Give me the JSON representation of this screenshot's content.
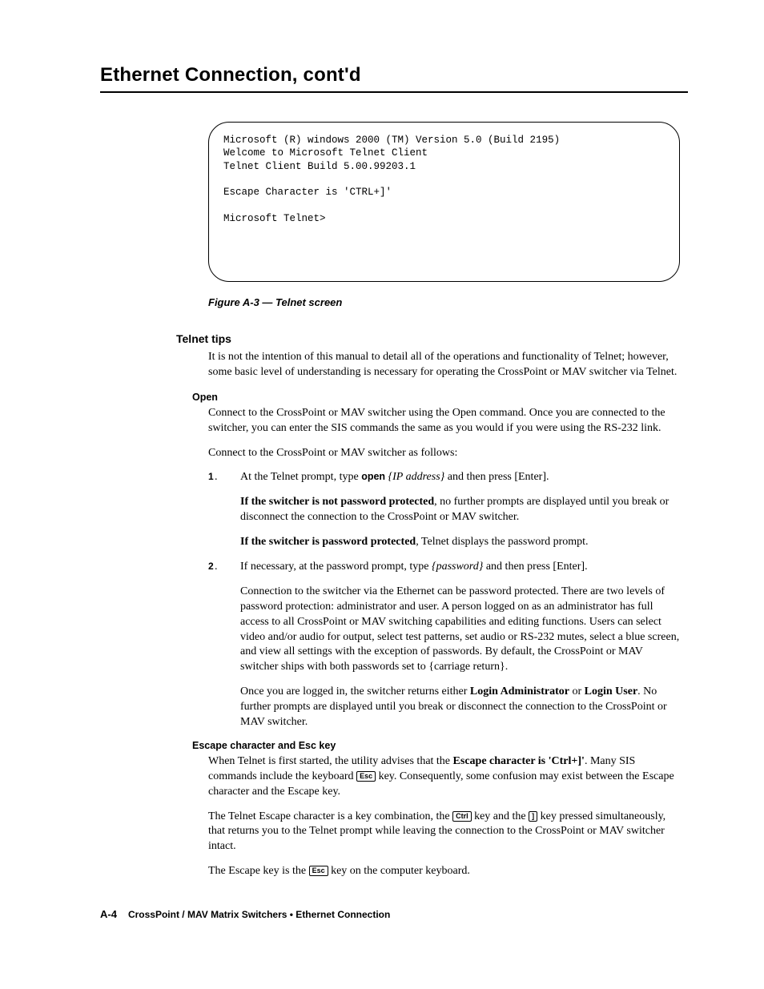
{
  "chapter": {
    "title": "Ethernet Connection, cont'd"
  },
  "telnet": {
    "line1": "Microsoft (R) windows 2000 (TM) Version 5.0 (Build 2195)",
    "line2": "Welcome to Microsoft Telnet Client",
    "line3": "Telnet Client Build 5.00.99203.1",
    "line4": "Escape Character is 'CTRL+]'",
    "line5": "Microsoft Telnet>"
  },
  "figure": {
    "caption": "Figure A-3 — Telnet screen"
  },
  "tips": {
    "heading": "Telnet tips",
    "intro": "It is not the intention of this manual to detail all of the operations and functionality of Telnet; however, some basic level of understanding is necessary for operating the CrossPoint or MAV switcher via Telnet."
  },
  "open": {
    "heading": "Open",
    "p1": "Connect to the CrossPoint or MAV switcher using the Open command.  Once you are connected to the switcher, you can enter the SIS commands the same as you would if you were using the RS-232 link.",
    "p2": "Connect to the CrossPoint or MAV switcher as follows:",
    "step1_lead": "At the Telnet prompt, type ",
    "step1_cmd": "open",
    "step1_arg": " {IP address}",
    "step1_tail": " and then press [Enter].",
    "step1_np_lead": "If the switcher is not password protected",
    "step1_np_tail": ", no further prompts are displayed until you break or disconnect the connection to the CrossPoint or MAV switcher.",
    "step1_pp_lead": "If the switcher is password protected",
    "step1_pp_tail": ", Telnet displays the password prompt.",
    "step2_lead": "If necessary, at the password prompt, type ",
    "step2_arg": "{password}",
    "step2_tail": " and then press [Enter].",
    "step2_p2": "Connection to the switcher via the Ethernet can be password protected.  There are two levels of password protection: administrator and user.  A person logged on as an administrator has full access to all CrossPoint or MAV switching capabilities and editing functions.  Users can select video and/or audio for output, select test patterns, set audio or RS-232 mutes, select a blue screen, and view all settings with the exception of passwords.  By default, the CrossPoint or MAV switcher ships with both passwords set to {carriage return}.",
    "step2_p3a": "Once you are logged in, the switcher returns either ",
    "step2_la": "Login Administrator",
    "step2_or": " or ",
    "step2_lu": "Login User",
    "step2_p3b": ".  No further prompts are displayed until you break or disconnect the connection to the CrossPoint or MAV switcher."
  },
  "escape": {
    "heading": "Escape character and Esc key",
    "p1a": "When Telnet is first started, the utility advises that the ",
    "p1b": "Escape character is 'Ctrl+]'",
    "p1c": ".  Many SIS commands include the keyboard ",
    "key_esc": "Esc",
    "p1d": " key.  Consequently, some confusion may exist between the Escape character and the Escape key.",
    "p2a": "The Telnet Escape character is a key combination, the ",
    "key_ctrl": "Ctrl",
    "p2b": " key and the ",
    "key_bracket": "]",
    "p2c": " key pressed simultaneously, that returns you to the Telnet prompt while leaving the connection to the CrossPoint or MAV switcher intact.",
    "p3a": "The Escape key is the ",
    "p3b": " key on the computer keyboard."
  },
  "footer": {
    "page": "A-4",
    "text": "CrossPoint / MAV Matrix Switchers • Ethernet Connection"
  }
}
